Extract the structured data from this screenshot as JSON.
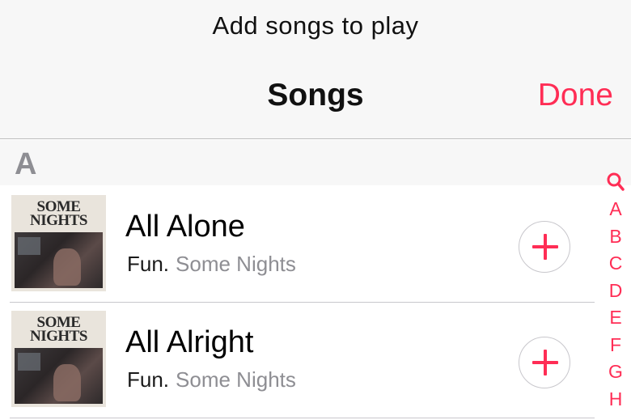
{
  "header": {
    "prompt": "Add songs to play",
    "title": "Songs",
    "done_label": "Done"
  },
  "section": {
    "letter": "A"
  },
  "songs": [
    {
      "title": "All Alone",
      "artist": "Fun.",
      "album": "Some Nights",
      "art_text": "SOME\nNIGHTS"
    },
    {
      "title": "All Alright",
      "artist": "Fun.",
      "album": "Some Nights",
      "art_text": "SOME\nNIGHTS"
    }
  ],
  "index": {
    "search_icon": "magnifier-icon",
    "letters": [
      "A",
      "B",
      "C",
      "D",
      "E",
      "F",
      "G",
      "H"
    ]
  },
  "colors": {
    "accent": "#ff2d55",
    "secondary_text": "#8e8e93",
    "header_bg": "#f7f7f7"
  }
}
